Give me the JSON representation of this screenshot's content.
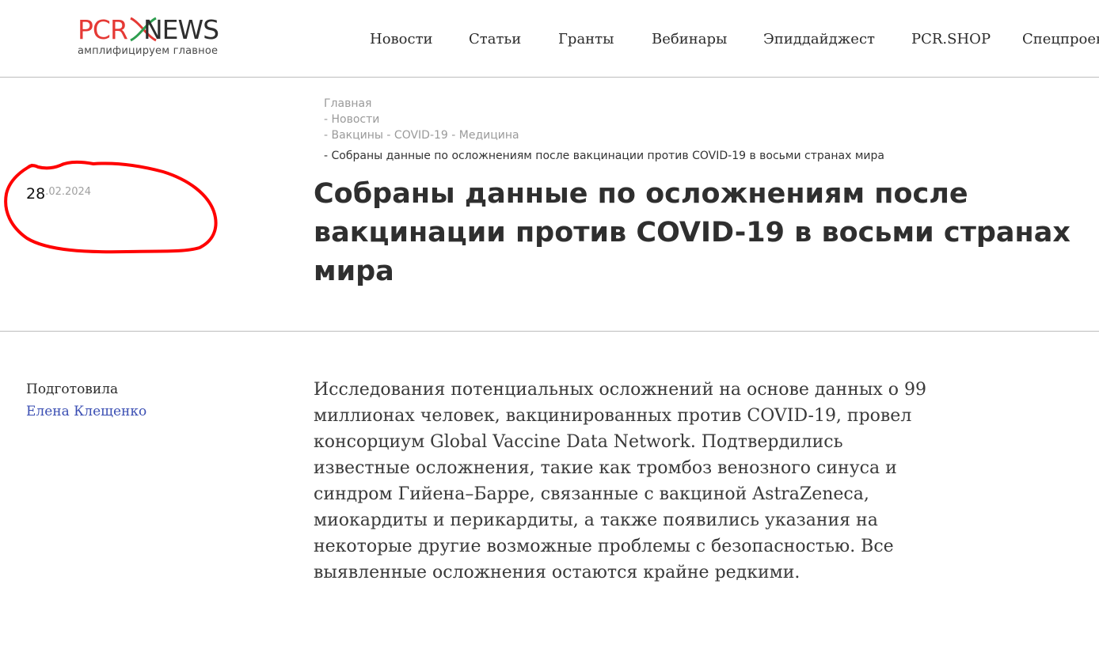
{
  "logo": {
    "brand_left": "PCR",
    "brand_right": "NEWS",
    "tagline": "амплифицируем главное",
    "colors": {
      "pcr": "#e53935",
      "x_red": "#e53935",
      "x_green": "#2e9e4f",
      "news": "#2e2e2e"
    }
  },
  "nav": {
    "items": [
      {
        "label": "Новости"
      },
      {
        "label": "Статьи"
      },
      {
        "label": "Гранты"
      },
      {
        "label": "Вебинары"
      },
      {
        "label": "Эпиддайджест"
      },
      {
        "label": "PCR.SHOP"
      },
      {
        "label": "Спецпроек"
      }
    ]
  },
  "breadcrumbs": {
    "home": "Главная",
    "news": "- Новости",
    "tags": "- Вакцины - COVID-19 - Медицина",
    "current": "- Собраны данные по осложнениям после вакцинации против COVID-19 в восьми странах мира"
  },
  "date": {
    "day": "28",
    "rest": ".02.2024"
  },
  "article": {
    "title": "Собраны данные по осложнениям после вакцинации против COVID-19 в восьми странах мира",
    "author_label": "Подготовила",
    "author_name": "Елена Клещенко",
    "lead": "Исследования потенциальных осложнений на основе данных о 99 миллионах человек, вакцинированных против COVID-19, провел консорциум Global Vaccine Data Network. Подтвердились известные осложнения, такие как тромбоз венозного синуса и синдром Гийена–Барре, связанные с вакциной AstraZeneca, миокардиты и перикардиты, а также появились указания на некоторые другие возможные проблемы с безопасностью. Все выявленные осложнения остаются крайне редкими."
  },
  "colors": {
    "author_link": "#3b4fb3",
    "annotation": "#ff0000",
    "divider": "#bdbdbd"
  }
}
